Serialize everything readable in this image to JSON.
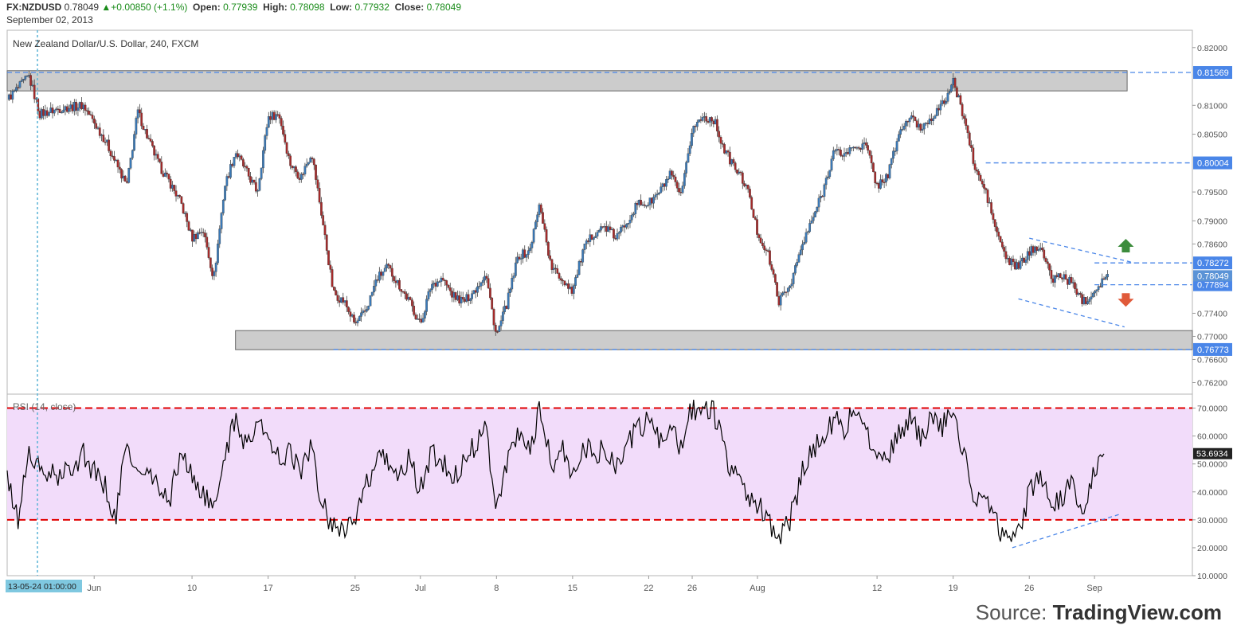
{
  "header": {
    "symbol": "FX:NZDUSD",
    "last": "0.78049",
    "change": "+0.00850 (+1.1%)",
    "open_label": "Open:",
    "open": "0.77939",
    "high_label": "High:",
    "high": "0.78098",
    "low_label": "Low:",
    "low": "0.77932",
    "close_label": "Close:",
    "close": "0.78049",
    "date": "September 02, 2013"
  },
  "pane_title": "New Zealand Dollar/U.S. Dollar, 240, FXCM",
  "rsi_title": "RSI (14, close)",
  "source": {
    "prefix": "Source: ",
    "brand": "TradingView.com"
  },
  "cursor_date_label": "13-05-24 01:00:00",
  "colors": {
    "up_candle": "#3a79b7",
    "down_candle": "#a52a2a",
    "wick": "#444444",
    "zone_fill": "#cccccc",
    "level_line": "#4a86e8",
    "rsi_band": "#f2dcfa",
    "rsi_line": "#000000",
    "rsi_levels": "#e00000",
    "last_label": "#4a86e8",
    "arrow_up": "#3c8c3c",
    "arrow_down": "#e05a3a"
  },
  "chart_data": [
    {
      "type": "candlestick",
      "title": "New Zealand Dollar/U.S. Dollar, 240, FXCM",
      "ylim": [
        0.76,
        0.823
      ],
      "y_ticks": [
        "0.82000",
        "0.81000",
        "0.80500",
        "0.79500",
        "0.79000",
        "0.78600",
        "0.77400",
        "0.77000",
        "0.76600",
        "0.76200"
      ],
      "x_ticks": [
        "Jun",
        "10",
        "17",
        "25",
        "Jul",
        "8",
        "15",
        "22",
        "26",
        "Aug",
        "12",
        "19",
        "26",
        "Sep"
      ],
      "x_tick_dates": [
        "2013-06-01",
        "2013-06-10",
        "2013-06-17",
        "2013-06-25",
        "2013-07-01",
        "2013-07-08",
        "2013-07-15",
        "2013-07-22",
        "2013-07-26",
        "2013-08-01",
        "2013-08-12",
        "2013-08-19",
        "2013-08-26",
        "2013-09-01"
      ],
      "x_range": [
        "2013-05-24",
        "2013-09-10"
      ],
      "price_path": [
        [
          "2013-05-24",
          0.811
        ],
        [
          "2013-05-26",
          0.815
        ],
        [
          "2013-05-27",
          0.8085
        ],
        [
          "2013-05-29",
          0.8095
        ],
        [
          "2013-05-31",
          0.81
        ],
        [
          "2013-06-02",
          0.804
        ],
        [
          "2013-06-04",
          0.796
        ],
        [
          "2013-06-05",
          0.809
        ],
        [
          "2013-06-06",
          0.804
        ],
        [
          "2013-06-07",
          0.7995
        ],
        [
          "2013-06-08",
          0.7965
        ],
        [
          "2013-06-09",
          0.793
        ],
        [
          "2013-06-10",
          0.787
        ],
        [
          "2013-06-11",
          0.7885
        ],
        [
          "2013-06-12",
          0.78
        ],
        [
          "2013-06-13",
          0.796
        ],
        [
          "2013-06-14",
          0.802
        ],
        [
          "2013-06-16",
          0.795
        ],
        [
          "2013-06-17",
          0.808
        ],
        [
          "2013-06-18",
          0.8085
        ],
        [
          "2013-06-19",
          0.8
        ],
        [
          "2013-06-20",
          0.7975
        ],
        [
          "2013-06-21",
          0.802
        ],
        [
          "2013-06-22",
          0.79
        ],
        [
          "2013-06-23",
          0.7775
        ],
        [
          "2013-06-24",
          0.776
        ],
        [
          "2013-06-25",
          0.772
        ],
        [
          "2013-06-26",
          0.7745
        ],
        [
          "2013-06-27",
          0.78
        ],
        [
          "2013-06-28",
          0.782
        ],
        [
          "2013-06-29",
          0.779
        ],
        [
          "2013-06-30",
          0.776
        ],
        [
          "2013-07-01",
          0.772
        ],
        [
          "2013-07-02",
          0.779
        ],
        [
          "2013-07-03",
          0.78
        ],
        [
          "2013-07-04",
          0.777
        ],
        [
          "2013-07-05",
          0.776
        ],
        [
          "2013-07-06",
          0.778
        ],
        [
          "2013-07-07",
          0.781
        ],
        [
          "2013-07-08",
          0.77
        ],
        [
          "2013-07-09",
          0.776
        ],
        [
          "2013-07-10",
          0.784
        ],
        [
          "2013-07-11",
          0.7845
        ],
        [
          "2013-07-12",
          0.793
        ],
        [
          "2013-07-13",
          0.782
        ],
        [
          "2013-07-14",
          0.78
        ],
        [
          "2013-07-15",
          0.778
        ],
        [
          "2013-07-16",
          0.785
        ],
        [
          "2013-07-17",
          0.788
        ],
        [
          "2013-07-18",
          0.789
        ],
        [
          "2013-07-19",
          0.787
        ],
        [
          "2013-07-20",
          0.79
        ],
        [
          "2013-07-21",
          0.793
        ],
        [
          "2013-07-22",
          0.793
        ],
        [
          "2013-07-23",
          0.795
        ],
        [
          "2013-07-24",
          0.798
        ],
        [
          "2013-07-25",
          0.794
        ],
        [
          "2013-07-26",
          0.806
        ],
        [
          "2013-07-27",
          0.808
        ],
        [
          "2013-07-28",
          0.8075
        ],
        [
          "2013-07-29",
          0.802
        ],
        [
          "2013-07-30",
          0.799
        ],
        [
          "2013-07-31",
          0.796
        ],
        [
          "2013-08-01",
          0.788
        ],
        [
          "2013-08-02",
          0.784
        ],
        [
          "2013-08-03",
          0.776
        ],
        [
          "2013-08-04",
          0.779
        ],
        [
          "2013-08-05",
          0.785
        ],
        [
          "2013-08-06",
          0.79
        ],
        [
          "2013-08-07",
          0.795
        ],
        [
          "2013-08-08",
          0.802
        ],
        [
          "2013-08-09",
          0.8015
        ],
        [
          "2013-08-10",
          0.803
        ],
        [
          "2013-08-11",
          0.803
        ],
        [
          "2013-08-12",
          0.796
        ],
        [
          "2013-08-13",
          0.798
        ],
        [
          "2013-08-14",
          0.805
        ],
        [
          "2013-08-15",
          0.808
        ],
        [
          "2013-08-16",
          0.806
        ],
        [
          "2013-08-17",
          0.808
        ],
        [
          "2013-08-18",
          0.81
        ],
        [
          "2013-08-19",
          0.814
        ],
        [
          "2013-08-20",
          0.808
        ],
        [
          "2013-08-21",
          0.799
        ],
        [
          "2013-08-22",
          0.795
        ],
        [
          "2013-08-23",
          0.788
        ],
        [
          "2013-08-24",
          0.783
        ],
        [
          "2013-08-25",
          0.782
        ],
        [
          "2013-08-26",
          0.7845
        ],
        [
          "2013-08-27",
          0.786
        ],
        [
          "2013-08-28",
          0.78
        ],
        [
          "2013-08-29",
          0.7805
        ],
        [
          "2013-08-30",
          0.779
        ],
        [
          "2013-08-31",
          0.776
        ],
        [
          "2013-09-01",
          0.778
        ],
        [
          "2013-09-02",
          0.7805
        ]
      ],
      "levels": [
        {
          "label": "0.81569",
          "value": 0.81569,
          "style": "dashed"
        },
        {
          "label": "0.80004",
          "value": 0.80004,
          "style": "dashed",
          "from": "2013-08-22"
        },
        {
          "label": "0.78272",
          "value": 0.78272,
          "style": "dashed",
          "from": "2013-09-01"
        },
        {
          "label": "0.77894",
          "value": 0.77894,
          "style": "dashed",
          "from": "2013-09-01"
        },
        {
          "label": "0.76773",
          "value": 0.76773,
          "style": "dashed",
          "from": "2013-06-23"
        }
      ],
      "last_price_label": "0.78049",
      "last_price": 0.78049,
      "zones": [
        {
          "from": "2013-05-24",
          "to": "2013-09-04",
          "y_low": 0.8125,
          "y_high": 0.816
        },
        {
          "from": "2013-06-14",
          "to": "2013-09-10",
          "y_low": 0.7677,
          "y_high": 0.771
        }
      ],
      "trend_lines": [
        {
          "from": [
            "2013-08-26",
            0.787
          ],
          "to": [
            "2013-09-03",
            0.782
          ]
        },
        {
          "from": [
            "2013-08-25",
            0.7765
          ],
          "to": [
            "2013-09-02",
            0.7708
          ]
        }
      ],
      "arrows": [
        {
          "direction": "up",
          "date": "2013-09-03",
          "value": 0.7855
        },
        {
          "direction": "down",
          "date": "2013-09-03",
          "value": 0.7765
        }
      ]
    },
    {
      "type": "line",
      "title": "RSI (14, close)",
      "ylim": [
        10,
        75
      ],
      "y_ticks": [
        "70.0000",
        "60.0000",
        "50.0000",
        "40.0000",
        "30.0000",
        "20.0000",
        "10.0000"
      ],
      "levels": [
        70,
        30
      ],
      "last_value_label": "53.6934",
      "last_value": 53.6934,
      "rsi_path": [
        [
          "2013-05-24",
          44
        ],
        [
          "2013-05-25",
          30
        ],
        [
          "2013-05-26",
          55
        ],
        [
          "2013-05-27",
          47
        ],
        [
          "2013-05-29",
          45
        ],
        [
          "2013-05-31",
          54
        ],
        [
          "2013-06-01",
          47
        ],
        [
          "2013-06-02",
          42
        ],
        [
          "2013-06-03",
          30
        ],
        [
          "2013-06-04",
          59
        ],
        [
          "2013-06-05",
          45
        ],
        [
          "2013-06-06",
          47
        ],
        [
          "2013-06-07",
          40
        ],
        [
          "2013-06-08",
          38
        ],
        [
          "2013-06-09",
          55
        ],
        [
          "2013-06-10",
          45
        ],
        [
          "2013-06-11",
          40
        ],
        [
          "2013-06-12",
          32
        ],
        [
          "2013-06-13",
          54
        ],
        [
          "2013-06-14",
          65
        ],
        [
          "2013-06-15",
          57
        ],
        [
          "2013-06-16",
          66
        ],
        [
          "2013-06-17",
          58
        ],
        [
          "2013-06-18",
          52
        ],
        [
          "2013-06-19",
          55
        ],
        [
          "2013-06-20",
          47
        ],
        [
          "2013-06-21",
          56
        ],
        [
          "2013-06-22",
          35
        ],
        [
          "2013-06-23",
          28
        ],
        [
          "2013-06-24",
          28
        ],
        [
          "2013-06-25",
          29
        ],
        [
          "2013-06-26",
          42
        ],
        [
          "2013-06-27",
          50
        ],
        [
          "2013-06-28",
          52
        ],
        [
          "2013-06-29",
          45
        ],
        [
          "2013-06-30",
          52
        ],
        [
          "2013-07-01",
          40
        ],
        [
          "2013-07-02",
          55
        ],
        [
          "2013-07-03",
          50
        ],
        [
          "2013-07-04",
          46
        ],
        [
          "2013-07-05",
          50
        ],
        [
          "2013-07-06",
          57
        ],
        [
          "2013-07-07",
          64
        ],
        [
          "2013-07-08",
          35
        ],
        [
          "2013-07-09",
          50
        ],
        [
          "2013-07-10",
          62
        ],
        [
          "2013-07-11",
          55
        ],
        [
          "2013-07-12",
          70
        ],
        [
          "2013-07-13",
          50
        ],
        [
          "2013-07-14",
          55
        ],
        [
          "2013-07-15",
          46
        ],
        [
          "2013-07-16",
          58
        ],
        [
          "2013-07-17",
          52
        ],
        [
          "2013-07-18",
          56
        ],
        [
          "2013-07-19",
          50
        ],
        [
          "2013-07-20",
          58
        ],
        [
          "2013-07-21",
          62
        ],
        [
          "2013-07-22",
          66
        ],
        [
          "2013-07-23",
          58
        ],
        [
          "2013-07-24",
          62
        ],
        [
          "2013-07-25",
          55
        ],
        [
          "2013-07-26",
          71
        ],
        [
          "2013-07-27",
          68
        ],
        [
          "2013-07-28",
          69
        ],
        [
          "2013-07-29",
          54
        ],
        [
          "2013-07-30",
          46
        ],
        [
          "2013-07-31",
          40
        ],
        [
          "2013-08-01",
          35
        ],
        [
          "2013-08-02",
          30
        ],
        [
          "2013-08-03",
          24
        ],
        [
          "2013-08-04",
          30
        ],
        [
          "2013-08-05",
          45
        ],
        [
          "2013-08-06",
          56
        ],
        [
          "2013-08-07",
          58
        ],
        [
          "2013-08-08",
          66
        ],
        [
          "2013-08-09",
          63
        ],
        [
          "2013-08-10",
          70
        ],
        [
          "2013-08-11",
          60
        ],
        [
          "2013-08-12",
          55
        ],
        [
          "2013-08-13",
          52
        ],
        [
          "2013-08-14",
          60
        ],
        [
          "2013-08-15",
          67
        ],
        [
          "2013-08-16",
          60
        ],
        [
          "2013-08-17",
          65
        ],
        [
          "2013-08-18",
          64
        ],
        [
          "2013-08-19",
          67
        ],
        [
          "2013-08-20",
          55
        ],
        [
          "2013-08-21",
          38
        ],
        [
          "2013-08-22",
          36
        ],
        [
          "2013-08-23",
          28
        ],
        [
          "2013-08-24",
          24
        ],
        [
          "2013-08-25",
          25
        ],
        [
          "2013-08-26",
          40
        ],
        [
          "2013-08-27",
          48
        ],
        [
          "2013-08-28",
          34
        ],
        [
          "2013-08-29",
          38
        ],
        [
          "2013-08-30",
          42
        ],
        [
          "2013-08-31",
          33
        ],
        [
          "2013-09-01",
          48
        ],
        [
          "2013-09-02",
          54
        ]
      ],
      "trend_lines": [
        {
          "from": [
            "2013-08-24",
            20
          ],
          "to": [
            "2013-09-02",
            32
          ]
        }
      ]
    }
  ]
}
